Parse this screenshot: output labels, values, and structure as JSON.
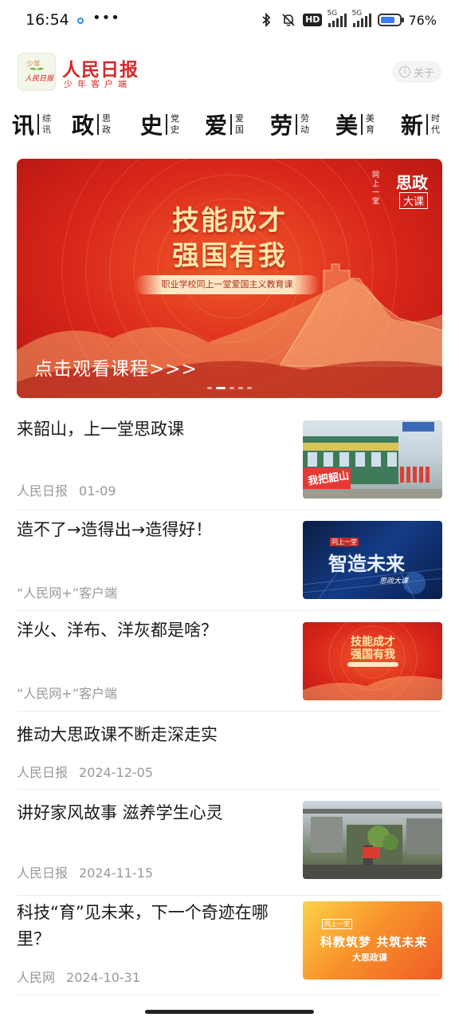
{
  "status_bar": {
    "time": "16:54",
    "more": "•••",
    "hd": "HD",
    "net1": "5G",
    "net2": "5G",
    "battery_percent": 76,
    "battery_text": "76%"
  },
  "app": {
    "logo_top": "少年",
    "logo_bottom": "人民日报",
    "title": "人民日报",
    "subtitle": "少年客户端",
    "about_label": "关于"
  },
  "categories": [
    {
      "big": "讯",
      "small1": "综",
      "small2": "讯"
    },
    {
      "big": "政",
      "small1": "思",
      "small2": "政"
    },
    {
      "big": "史",
      "small1": "党",
      "small2": "史"
    },
    {
      "big": "爱",
      "small1": "爱",
      "small2": "国"
    },
    {
      "big": "劳",
      "small1": "劳",
      "small2": "动"
    },
    {
      "big": "美",
      "small1": "美",
      "small2": "育"
    },
    {
      "big": "新",
      "small1": "时",
      "small2": "代"
    }
  ],
  "banner": {
    "headline_line1": "技能成才",
    "headline_line2": "强国有我",
    "ribbon": "职业学校同上一堂爱国主义教育课",
    "logo_big": "思政",
    "logo_small": "同上一堂",
    "logo_box": "大课",
    "cta": "点击观看课程>>>",
    "page_count": 5,
    "active_page": 2
  },
  "news": [
    {
      "title": "来韶山，上一堂思政课",
      "source": "人民日报",
      "date": "01-09",
      "thumb_text": "我把韶山"
    },
    {
      "title": "造不了→造得出→造得好！",
      "source": "“人民网+”客户端",
      "date": "",
      "thumb_tag": "同上一堂",
      "thumb_text": "智造未来",
      "thumb_sub": "思政大课"
    },
    {
      "title": "洋火、洋布、洋灰都是啥？",
      "source": "“人民网+”客户端",
      "date": "",
      "thumb_text": "技能成才",
      "thumb_text2": "强国有我"
    },
    {
      "title": "推动大思政课不断走深走实",
      "source": "人民日报",
      "date": "2024-12-05"
    },
    {
      "title": "讲好家风故事 滋养学生心灵",
      "source": "人民日报",
      "date": "2024-11-15"
    },
    {
      "title": "科技“育”见未来，下一个奇迹在哪里？",
      "source": "人民网",
      "date": "2024-10-31",
      "thumb_tag": "同上一堂",
      "thumb_text": "科教筑梦 共筑未来",
      "thumb_sub": "大思政课"
    }
  ]
}
